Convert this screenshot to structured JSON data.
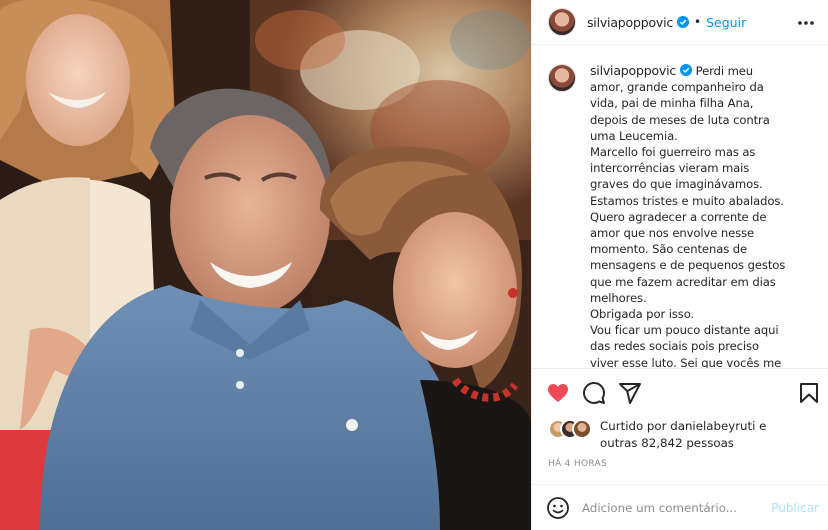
{
  "post": {
    "username": "silviapoppovic",
    "follow_label": "Seguir",
    "separator": "•",
    "caption": "Perdi meu amor, grande companheiro da vida, pai de minha filha Ana, depois de meses de luta contra uma Leucemia.\nMarcello foi guerreiro mas as intercorrências vieram mais graves do que imaginávamos. Estamos tristes e muito abalados.\nQuero agradecer a corrente de amor que nos envolve nesse momento. São centenas de mensagens e de pequenos gestos que me fazem acreditar em dias melhores.\nObrigada por isso.\nVou ficar um pouco distante aqui das redes sociais pois preciso viver esse luto. Sei que vocês me entenderão!",
    "liked_by_prefix": "Curtido por ",
    "liked_by_user": "danielabeyruti",
    "liked_by_suffix": " e outras 82,842 pessoas",
    "time_ago": "HÁ 4 HORAS",
    "comment_placeholder": "Adicione um comentário...",
    "publish_label": "Publicar"
  },
  "colors": {
    "accent": "#0095f6",
    "like_red": "#ed4956",
    "text": "#262626",
    "muted": "#8e8e8e"
  },
  "icons": {
    "more": "more-options-icon",
    "like": "heart-filled-icon",
    "comment": "comment-bubble-icon",
    "share": "paper-plane-icon",
    "save": "bookmark-icon",
    "emoji": "smiley-icon",
    "verified": "verified-badge-icon"
  }
}
